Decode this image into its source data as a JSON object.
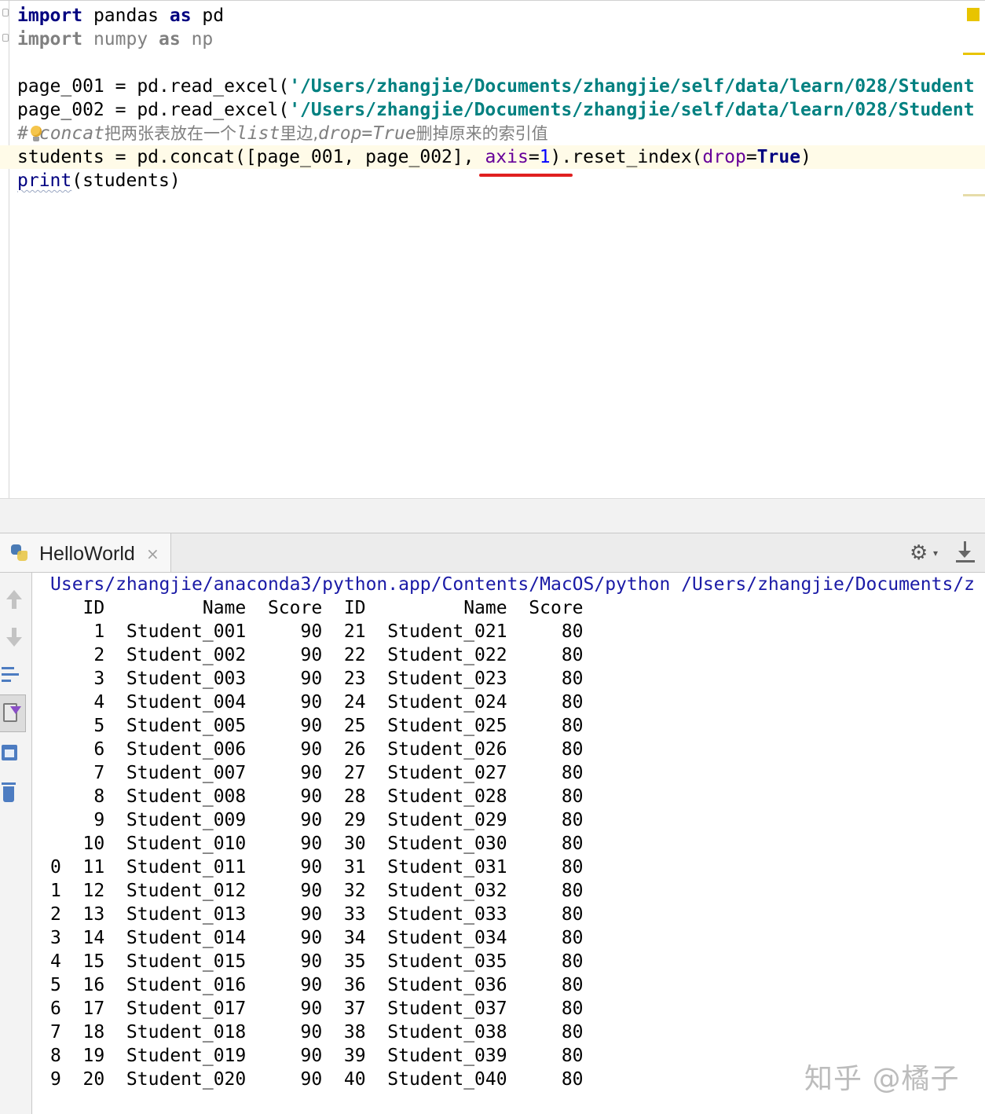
{
  "editor": {
    "line1": {
      "kw1": "import",
      "mod": " pandas ",
      "kw2": "as",
      "alias": " pd"
    },
    "line2": {
      "kw1": "import",
      "mod": " numpy ",
      "kw2": "as",
      "alias": " np"
    },
    "line4": {
      "pre": "page_001 = pd.read_excel(",
      "str": "'/Users/zhangjie/Documents/zhangjie/self/data/learn/028/Student"
    },
    "line5": {
      "pre": "page_002 = pd.read_excel(",
      "str": "'/Users/zhangjie/Documents/zhangjie/self/data/learn/028/Student"
    },
    "line6": {
      "hash": "#",
      "t1": "concat",
      "c1": "把两张表放在一个",
      "t2": "list",
      "c2": "里边,",
      "t3": "drop=True",
      "c3": "删掉原来的索引值"
    },
    "line7": {
      "pre": "students = pd.concat([page_001, page_002], ",
      "param": "axis",
      "eq": "=",
      "num": "1",
      "mid": ").reset_index(",
      "param2": "drop",
      "eq2": "=",
      "tru": "True",
      "end": ")"
    },
    "line8": {
      "fn": "print",
      "rest": "(students)"
    }
  },
  "run": {
    "tab_label": "HelloWorld",
    "close_glyph": "×",
    "gear_glyph": "⚙",
    "caret_glyph": "▾",
    "path_line": "Users/zhangjie/anaconda3/python.app/Contents/MacOS/python /Users/zhangjie/Documents/z",
    "header": [
      "ID",
      "Name",
      "Score",
      "ID",
      "Name",
      "Score"
    ],
    "rows": [
      [
        "",
        "1",
        "Student_001",
        "90",
        "21",
        "Student_021",
        "80"
      ],
      [
        "",
        "2",
        "Student_002",
        "90",
        "22",
        "Student_022",
        "80"
      ],
      [
        "",
        "3",
        "Student_003",
        "90",
        "23",
        "Student_023",
        "80"
      ],
      [
        "",
        "4",
        "Student_004",
        "90",
        "24",
        "Student_024",
        "80"
      ],
      [
        "",
        "5",
        "Student_005",
        "90",
        "25",
        "Student_025",
        "80"
      ],
      [
        "",
        "6",
        "Student_006",
        "90",
        "26",
        "Student_026",
        "80"
      ],
      [
        "",
        "7",
        "Student_007",
        "90",
        "27",
        "Student_027",
        "80"
      ],
      [
        "",
        "8",
        "Student_008",
        "90",
        "28",
        "Student_028",
        "80"
      ],
      [
        "",
        "9",
        "Student_009",
        "90",
        "29",
        "Student_029",
        "80"
      ],
      [
        "",
        "10",
        "Student_010",
        "90",
        "30",
        "Student_030",
        "80"
      ],
      [
        "0",
        "11",
        "Student_011",
        "90",
        "31",
        "Student_031",
        "80"
      ],
      [
        "1",
        "12",
        "Student_012",
        "90",
        "32",
        "Student_032",
        "80"
      ],
      [
        "2",
        "13",
        "Student_013",
        "90",
        "33",
        "Student_033",
        "80"
      ],
      [
        "3",
        "14",
        "Student_014",
        "90",
        "34",
        "Student_034",
        "80"
      ],
      [
        "4",
        "15",
        "Student_015",
        "90",
        "35",
        "Student_035",
        "80"
      ],
      [
        "5",
        "16",
        "Student_016",
        "90",
        "36",
        "Student_036",
        "80"
      ],
      [
        "6",
        "17",
        "Student_017",
        "90",
        "37",
        "Student_037",
        "80"
      ],
      [
        "7",
        "18",
        "Student_018",
        "90",
        "38",
        "Student_038",
        "80"
      ],
      [
        "8",
        "19",
        "Student_019",
        "90",
        "39",
        "Student_039",
        "80"
      ],
      [
        "9",
        "20",
        "Student_020",
        "90",
        "40",
        "Student_040",
        "80"
      ]
    ]
  },
  "watermark": "知乎 @橘子",
  "colors": {
    "keyword": "#000080",
    "string": "#008080",
    "comment": "#808080",
    "param": "#660099",
    "number": "#0000ff",
    "annotation_underline": "#e02020",
    "console_path": "#1a1aa6"
  }
}
